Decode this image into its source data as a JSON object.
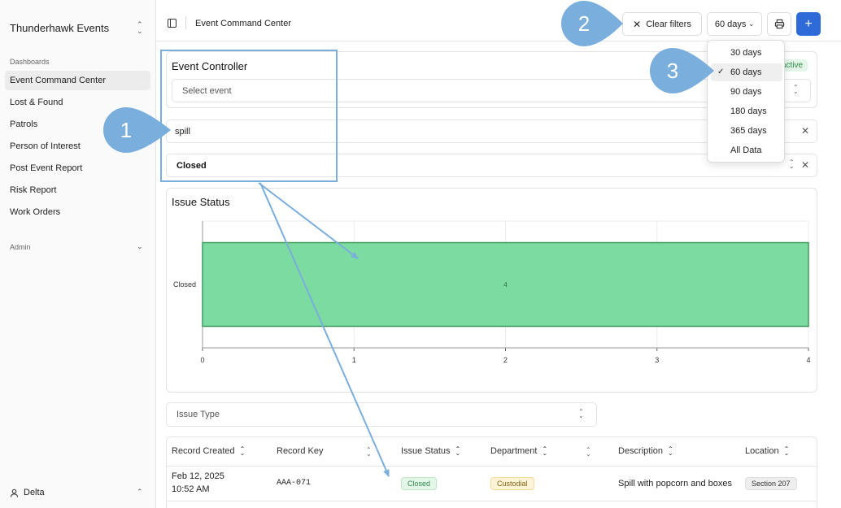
{
  "sidebar": {
    "brand": "Thunderhawk Events",
    "dashboards_label": "Dashboards",
    "items": [
      {
        "label": "Event Command Center"
      },
      {
        "label": "Lost & Found"
      },
      {
        "label": "Patrols"
      },
      {
        "label": "Person of Interest"
      },
      {
        "label": "Post Event Report"
      },
      {
        "label": "Risk Report"
      },
      {
        "label": "Work Orders"
      }
    ],
    "admin_label": "Admin",
    "user": "Delta"
  },
  "header": {
    "breadcrumb": "Event Command Center",
    "clear_filters": "Clear filters",
    "range_button": "60 days",
    "add_label": "+"
  },
  "event_controller": {
    "title": "Event Controller",
    "badge": "active",
    "placeholder": "Select event"
  },
  "filters": {
    "search_value": "spill",
    "status_value": "Closed"
  },
  "chart_data": {
    "type": "bar",
    "orientation": "horizontal",
    "title": "Issue Status",
    "categories": [
      "Closed"
    ],
    "values": [
      4
    ],
    "data_labels": [
      "4"
    ],
    "xlim": [
      0,
      4
    ],
    "xticks": [
      "0",
      "1",
      "2",
      "3",
      "4"
    ],
    "grid": true,
    "color": "#7cdba0"
  },
  "issue_type": {
    "placeholder": "Issue Type"
  },
  "table": {
    "columns": [
      "Record Created",
      "Record Key",
      "Issue Status",
      "Department",
      "Description",
      "Location"
    ],
    "rows": [
      {
        "date": "Feb 12, 2025",
        "time": "10:52 AM",
        "key": "AAA-071",
        "status": "Closed",
        "department": "Custodial",
        "description": "Spill with popcorn and boxes",
        "location": "Section 207"
      }
    ]
  },
  "dropdown": {
    "options": [
      "30 days",
      "60 days",
      "90 days",
      "180 days",
      "365 days",
      "All Data"
    ],
    "selected": "60 days"
  },
  "annotations": {
    "markers": [
      "1",
      "2",
      "3"
    ],
    "color": "#7aaedc"
  }
}
